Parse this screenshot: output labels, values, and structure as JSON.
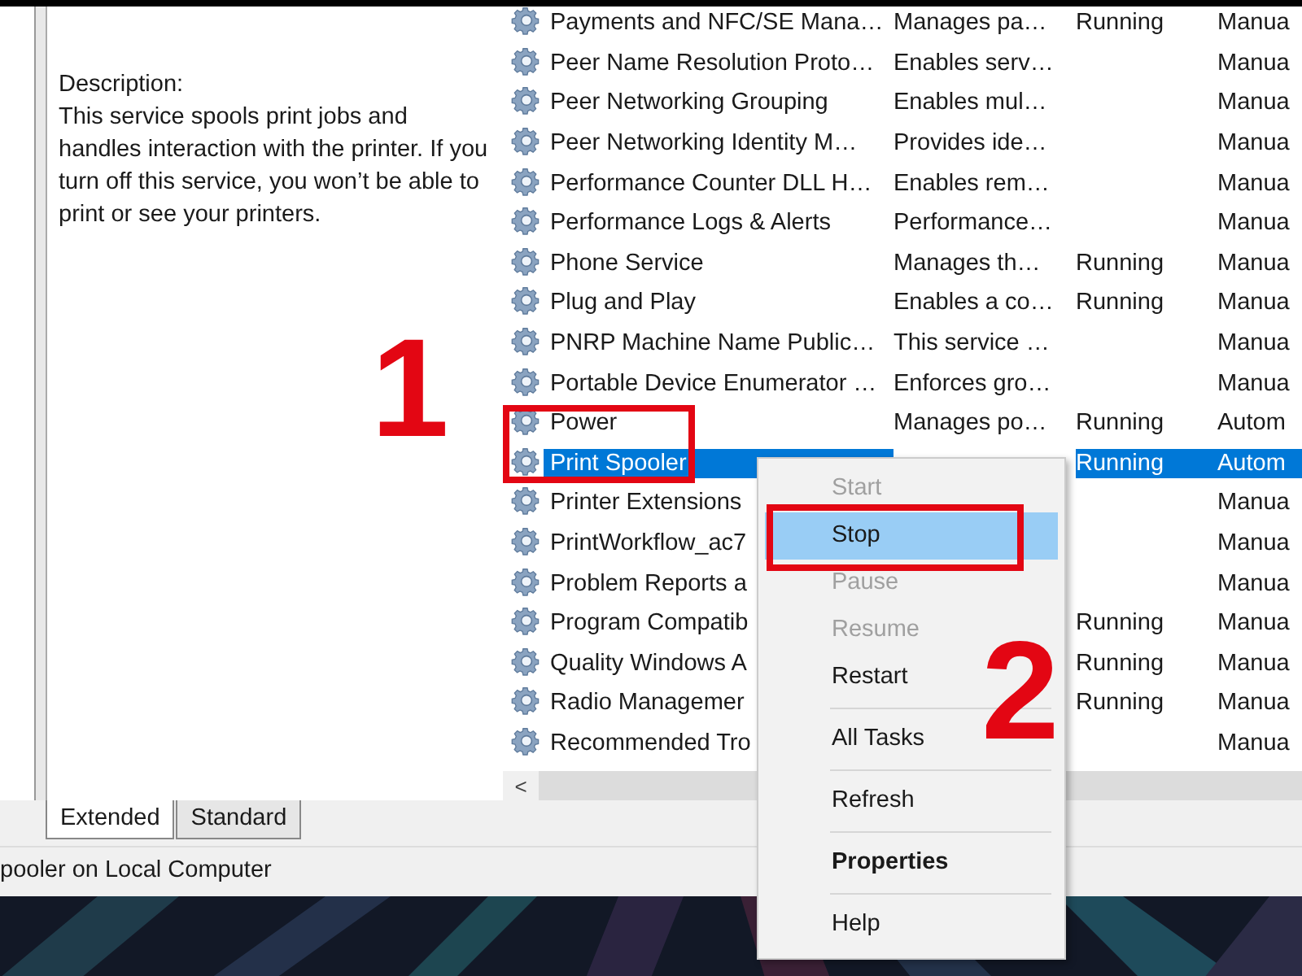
{
  "description": {
    "heading": "Description:",
    "text": "This service spools print jobs and handles interaction with the printer. If you turn off this service, you won’t be able to print or see your printers."
  },
  "services": [
    {
      "name": "Payments and NFC/SE Mana…",
      "description": "Manages pa…",
      "status": "Running",
      "startup": "Manua",
      "selected": false
    },
    {
      "name": "Peer Name Resolution Proto…",
      "description": "Enables serv…",
      "startup": "Manua",
      "selected": false
    },
    {
      "name": "Peer Networking Grouping",
      "description": "Enables mul…",
      "startup": "Manua",
      "selected": false
    },
    {
      "name": "Peer Networking Identity M…",
      "description": "Provides ide…",
      "startup": "Manua",
      "selected": false
    },
    {
      "name": "Performance Counter DLL H…",
      "description": "Enables rem…",
      "startup": "Manua",
      "selected": false
    },
    {
      "name": "Performance Logs & Alerts",
      "description": "Performance…",
      "startup": "Manua",
      "selected": false
    },
    {
      "name": "Phone Service",
      "description": "Manages th…",
      "status": "Running",
      "startup": "Manua",
      "selected": false
    },
    {
      "name": "Plug and Play",
      "description": "Enables a co…",
      "status": "Running",
      "startup": "Manua",
      "selected": false
    },
    {
      "name": "PNRP Machine Name Public…",
      "description": "This service …",
      "startup": "Manua",
      "selected": false
    },
    {
      "name": "Portable Device Enumerator …",
      "description": "Enforces gro…",
      "startup": "Manua",
      "selected": false
    },
    {
      "name": "Power",
      "description": "Manages po…",
      "status": "Running",
      "startup": "Autom",
      "selected": false
    },
    {
      "name": "Print Spooler",
      "status": "Running",
      "startup": "Autom",
      "selected": true
    },
    {
      "name": "Printer Extensions",
      "startup": "Manua",
      "selected": false
    },
    {
      "name": "PrintWorkflow_ac7",
      "startup": "Manua",
      "selected": false
    },
    {
      "name": "Problem Reports a",
      "startup": "Manua",
      "selected": false
    },
    {
      "name": "Program Compatib",
      "status": "Running",
      "startup": "Manua",
      "selected": false
    },
    {
      "name": "Quality Windows A",
      "status": "Running",
      "startup": "Manua",
      "selected": false
    },
    {
      "name": "Radio Managemer",
      "status": "Running",
      "startup": "Manua",
      "selected": false
    },
    {
      "name": "Recommended Tro",
      "startup": "Manua",
      "selected": false
    }
  ],
  "scroll_left_arrow": "<",
  "tabs": [
    {
      "label": "Extended",
      "selected": true
    },
    {
      "label": "Standard",
      "selected": false
    }
  ],
  "status_bar": "pooler on Local Computer",
  "context_menu": [
    {
      "kind": "item",
      "label": "Start",
      "disabled": true,
      "highlighted": false,
      "default": false
    },
    {
      "kind": "item",
      "label": "Stop",
      "disabled": false,
      "highlighted": true,
      "default": false
    },
    {
      "kind": "item",
      "label": "Pause",
      "disabled": true,
      "highlighted": false,
      "default": false
    },
    {
      "kind": "item",
      "label": "Resume",
      "disabled": true,
      "highlighted": false,
      "default": false
    },
    {
      "kind": "item",
      "label": "Restart",
      "disabled": false,
      "highlighted": false,
      "default": false
    },
    {
      "kind": "separator"
    },
    {
      "kind": "item",
      "label": "All Tasks",
      "disabled": false,
      "highlighted": false,
      "default": false
    },
    {
      "kind": "separator"
    },
    {
      "kind": "item",
      "label": "Refresh",
      "disabled": false,
      "highlighted": false,
      "default": false
    },
    {
      "kind": "separator"
    },
    {
      "kind": "item",
      "label": "Properties",
      "disabled": false,
      "highlighted": false,
      "default": true
    },
    {
      "kind": "separator"
    },
    {
      "kind": "item",
      "label": "Help",
      "disabled": false,
      "highlighted": false,
      "default": false
    }
  ],
  "step_numbers": [
    "1",
    "2"
  ]
}
